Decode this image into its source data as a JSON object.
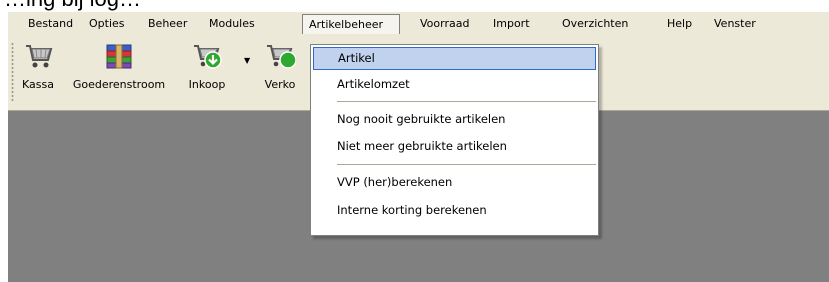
{
  "top_text": "…ing bij log…",
  "menubar": {
    "items": [
      {
        "label": "Bestand"
      },
      {
        "label": "Opties"
      },
      {
        "label": "Beheer"
      },
      {
        "label": "Modules"
      },
      {
        "label": "Artikelbeheer",
        "open": true
      },
      {
        "label": "Voorraad"
      },
      {
        "label": "Import"
      },
      {
        "label": "Overzichten"
      },
      {
        "label": "Help"
      },
      {
        "label": "Venster"
      }
    ]
  },
  "toolbar": {
    "buttons": [
      {
        "label": "Kassa",
        "icon": "shopping-cart-icon"
      },
      {
        "label": "Goederenstroom",
        "icon": "archive-books-icon"
      },
      {
        "label": "Inkoop",
        "icon": "cart-down-arrow-icon"
      },
      {
        "label": "Verko",
        "icon": "cart-up-arrow-icon"
      }
    ]
  },
  "dropdown": {
    "items": [
      {
        "label": "Artikel",
        "highlighted": true
      },
      {
        "label": "Artikelomzet"
      },
      {
        "separator": true
      },
      {
        "label": "Nog nooit gebruikte artikelen"
      },
      {
        "label": "Niet meer gebruikte artikelen"
      },
      {
        "separator": true
      },
      {
        "label": "VVP (her)berekenen"
      },
      {
        "label": "Interne korting berekenen"
      }
    ]
  },
  "colors": {
    "chrome": "#ece9d8",
    "workspace": "#808080",
    "highlight_bg": "#c1d2ee",
    "highlight_border": "#316ac5"
  }
}
